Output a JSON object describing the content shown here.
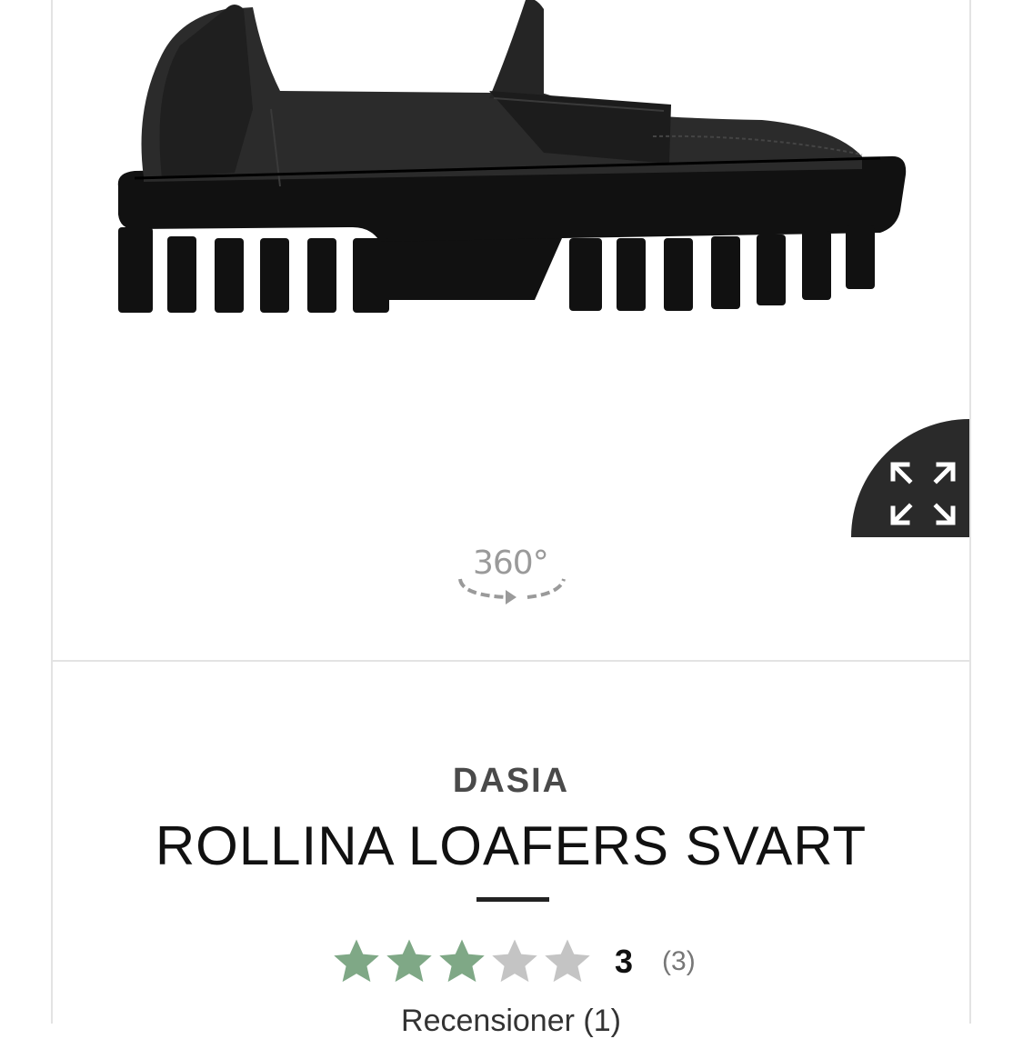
{
  "product": {
    "brand": "DASIA",
    "title": "ROLLINA LOAFERS SVART",
    "image_icon": "loafer-shoe-image"
  },
  "viewer": {
    "rotate_label": "360°",
    "zoom_icon": "expand-arrows-icon"
  },
  "rating": {
    "value": "3",
    "count": "(3)",
    "stars_filled": 3,
    "stars_total": 5,
    "filled_color": "#7fa886",
    "empty_color": "#c4c4c4"
  },
  "reviews": {
    "link_label": "Recensioner (1)"
  },
  "colors": {
    "zoom_button_bg": "#2a2a2a",
    "divider": "#e3e3e3"
  }
}
